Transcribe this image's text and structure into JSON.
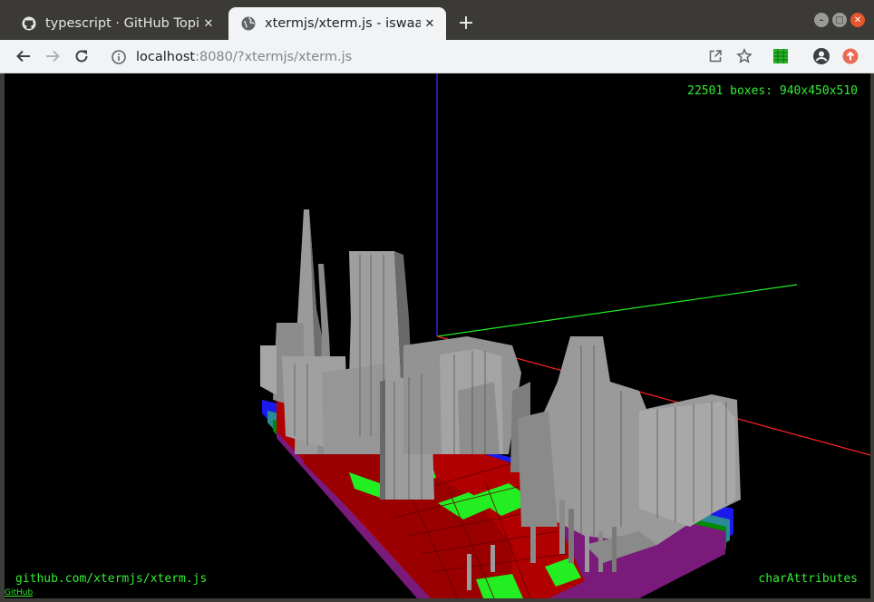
{
  "tabs": [
    {
      "label": "typescript · GitHub Topics",
      "icon": "github-icon",
      "active": false
    },
    {
      "label": "xtermjs/xterm.js - iswaac",
      "icon": "globe-icon",
      "active": true
    }
  ],
  "new_tab_label": "+",
  "address_bar": {
    "host": "localhost",
    "rest": ":8080/?xtermjs/xterm.js"
  },
  "hud": {
    "stats": "22501 boxes: 940x450x510",
    "repo_link": "github.com/xtermjs/xterm.js",
    "mode": "charAttributes",
    "github_link": "GitHub"
  },
  "colors": {
    "hud_green": "#33ee33",
    "box_red": "#b00000",
    "box_green": "#22ee22",
    "box_gray": "#9a9a9a",
    "box_blue": "#1a1aee",
    "axis_x": "#ff2222",
    "axis_y": "#22ee22",
    "axis_z": "#3322cc"
  }
}
